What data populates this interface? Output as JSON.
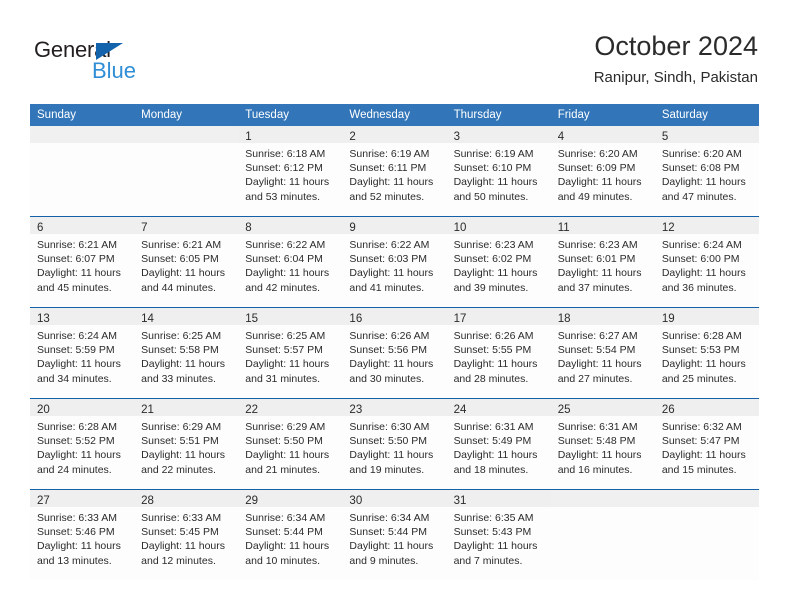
{
  "brand": {
    "name_part1": "General",
    "name_part2": "Blue",
    "triangle_color": "#1262ac",
    "blue_color": "#2f8ed6",
    "dark_color": "#231f20"
  },
  "header": {
    "title": "October 2024",
    "subtitle": "Ranipur, Sindh, Pakistan"
  },
  "theme": {
    "header_bg": "#3275b8",
    "week_separator": "#1461a8",
    "daynum_band_bg": "#efefef",
    "cell_bg": "#fdfdfd",
    "text_color": "#2b2b2b"
  },
  "weekdays": [
    "Sunday",
    "Monday",
    "Tuesday",
    "Wednesday",
    "Thursday",
    "Friday",
    "Saturday"
  ],
  "weeks": [
    [
      {
        "day": "",
        "sunrise": "",
        "sunset": "",
        "daylight_1": "",
        "daylight_2": ""
      },
      {
        "day": "",
        "sunrise": "",
        "sunset": "",
        "daylight_1": "",
        "daylight_2": ""
      },
      {
        "day": "1",
        "sunrise": "Sunrise: 6:18 AM",
        "sunset": "Sunset: 6:12 PM",
        "daylight_1": "Daylight: 11 hours",
        "daylight_2": "and 53 minutes."
      },
      {
        "day": "2",
        "sunrise": "Sunrise: 6:19 AM",
        "sunset": "Sunset: 6:11 PM",
        "daylight_1": "Daylight: 11 hours",
        "daylight_2": "and 52 minutes."
      },
      {
        "day": "3",
        "sunrise": "Sunrise: 6:19 AM",
        "sunset": "Sunset: 6:10 PM",
        "daylight_1": "Daylight: 11 hours",
        "daylight_2": "and 50 minutes."
      },
      {
        "day": "4",
        "sunrise": "Sunrise: 6:20 AM",
        "sunset": "Sunset: 6:09 PM",
        "daylight_1": "Daylight: 11 hours",
        "daylight_2": "and 49 minutes."
      },
      {
        "day": "5",
        "sunrise": "Sunrise: 6:20 AM",
        "sunset": "Sunset: 6:08 PM",
        "daylight_1": "Daylight: 11 hours",
        "daylight_2": "and 47 minutes."
      }
    ],
    [
      {
        "day": "6",
        "sunrise": "Sunrise: 6:21 AM",
        "sunset": "Sunset: 6:07 PM",
        "daylight_1": "Daylight: 11 hours",
        "daylight_2": "and 45 minutes."
      },
      {
        "day": "7",
        "sunrise": "Sunrise: 6:21 AM",
        "sunset": "Sunset: 6:05 PM",
        "daylight_1": "Daylight: 11 hours",
        "daylight_2": "and 44 minutes."
      },
      {
        "day": "8",
        "sunrise": "Sunrise: 6:22 AM",
        "sunset": "Sunset: 6:04 PM",
        "daylight_1": "Daylight: 11 hours",
        "daylight_2": "and 42 minutes."
      },
      {
        "day": "9",
        "sunrise": "Sunrise: 6:22 AM",
        "sunset": "Sunset: 6:03 PM",
        "daylight_1": "Daylight: 11 hours",
        "daylight_2": "and 41 minutes."
      },
      {
        "day": "10",
        "sunrise": "Sunrise: 6:23 AM",
        "sunset": "Sunset: 6:02 PM",
        "daylight_1": "Daylight: 11 hours",
        "daylight_2": "and 39 minutes."
      },
      {
        "day": "11",
        "sunrise": "Sunrise: 6:23 AM",
        "sunset": "Sunset: 6:01 PM",
        "daylight_1": "Daylight: 11 hours",
        "daylight_2": "and 37 minutes."
      },
      {
        "day": "12",
        "sunrise": "Sunrise: 6:24 AM",
        "sunset": "Sunset: 6:00 PM",
        "daylight_1": "Daylight: 11 hours",
        "daylight_2": "and 36 minutes."
      }
    ],
    [
      {
        "day": "13",
        "sunrise": "Sunrise: 6:24 AM",
        "sunset": "Sunset: 5:59 PM",
        "daylight_1": "Daylight: 11 hours",
        "daylight_2": "and 34 minutes."
      },
      {
        "day": "14",
        "sunrise": "Sunrise: 6:25 AM",
        "sunset": "Sunset: 5:58 PM",
        "daylight_1": "Daylight: 11 hours",
        "daylight_2": "and 33 minutes."
      },
      {
        "day": "15",
        "sunrise": "Sunrise: 6:25 AM",
        "sunset": "Sunset: 5:57 PM",
        "daylight_1": "Daylight: 11 hours",
        "daylight_2": "and 31 minutes."
      },
      {
        "day": "16",
        "sunrise": "Sunrise: 6:26 AM",
        "sunset": "Sunset: 5:56 PM",
        "daylight_1": "Daylight: 11 hours",
        "daylight_2": "and 30 minutes."
      },
      {
        "day": "17",
        "sunrise": "Sunrise: 6:26 AM",
        "sunset": "Sunset: 5:55 PM",
        "daylight_1": "Daylight: 11 hours",
        "daylight_2": "and 28 minutes."
      },
      {
        "day": "18",
        "sunrise": "Sunrise: 6:27 AM",
        "sunset": "Sunset: 5:54 PM",
        "daylight_1": "Daylight: 11 hours",
        "daylight_2": "and 27 minutes."
      },
      {
        "day": "19",
        "sunrise": "Sunrise: 6:28 AM",
        "sunset": "Sunset: 5:53 PM",
        "daylight_1": "Daylight: 11 hours",
        "daylight_2": "and 25 minutes."
      }
    ],
    [
      {
        "day": "20",
        "sunrise": "Sunrise: 6:28 AM",
        "sunset": "Sunset: 5:52 PM",
        "daylight_1": "Daylight: 11 hours",
        "daylight_2": "and 24 minutes."
      },
      {
        "day": "21",
        "sunrise": "Sunrise: 6:29 AM",
        "sunset": "Sunset: 5:51 PM",
        "daylight_1": "Daylight: 11 hours",
        "daylight_2": "and 22 minutes."
      },
      {
        "day": "22",
        "sunrise": "Sunrise: 6:29 AM",
        "sunset": "Sunset: 5:50 PM",
        "daylight_1": "Daylight: 11 hours",
        "daylight_2": "and 21 minutes."
      },
      {
        "day": "23",
        "sunrise": "Sunrise: 6:30 AM",
        "sunset": "Sunset: 5:50 PM",
        "daylight_1": "Daylight: 11 hours",
        "daylight_2": "and 19 minutes."
      },
      {
        "day": "24",
        "sunrise": "Sunrise: 6:31 AM",
        "sunset": "Sunset: 5:49 PM",
        "daylight_1": "Daylight: 11 hours",
        "daylight_2": "and 18 minutes."
      },
      {
        "day": "25",
        "sunrise": "Sunrise: 6:31 AM",
        "sunset": "Sunset: 5:48 PM",
        "daylight_1": "Daylight: 11 hours",
        "daylight_2": "and 16 minutes."
      },
      {
        "day": "26",
        "sunrise": "Sunrise: 6:32 AM",
        "sunset": "Sunset: 5:47 PM",
        "daylight_1": "Daylight: 11 hours",
        "daylight_2": "and 15 minutes."
      }
    ],
    [
      {
        "day": "27",
        "sunrise": "Sunrise: 6:33 AM",
        "sunset": "Sunset: 5:46 PM",
        "daylight_1": "Daylight: 11 hours",
        "daylight_2": "and 13 minutes."
      },
      {
        "day": "28",
        "sunrise": "Sunrise: 6:33 AM",
        "sunset": "Sunset: 5:45 PM",
        "daylight_1": "Daylight: 11 hours",
        "daylight_2": "and 12 minutes."
      },
      {
        "day": "29",
        "sunrise": "Sunrise: 6:34 AM",
        "sunset": "Sunset: 5:44 PM",
        "daylight_1": "Daylight: 11 hours",
        "daylight_2": "and 10 minutes."
      },
      {
        "day": "30",
        "sunrise": "Sunrise: 6:34 AM",
        "sunset": "Sunset: 5:44 PM",
        "daylight_1": "Daylight: 11 hours",
        "daylight_2": "and 9 minutes."
      },
      {
        "day": "31",
        "sunrise": "Sunrise: 6:35 AM",
        "sunset": "Sunset: 5:43 PM",
        "daylight_1": "Daylight: 11 hours",
        "daylight_2": "and 7 minutes."
      },
      {
        "day": "",
        "sunrise": "",
        "sunset": "",
        "daylight_1": "",
        "daylight_2": ""
      },
      {
        "day": "",
        "sunrise": "",
        "sunset": "",
        "daylight_1": "",
        "daylight_2": ""
      }
    ]
  ]
}
